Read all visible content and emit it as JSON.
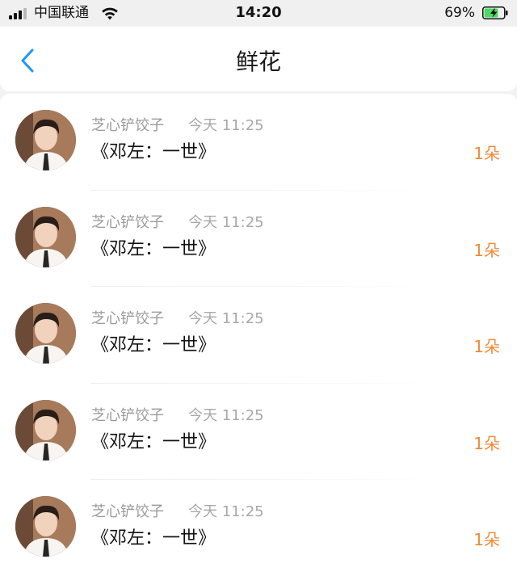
{
  "status_bar": {
    "carrier": "中国联通",
    "time": "14:20",
    "battery": "69%"
  },
  "header": {
    "title": "鲜花",
    "back_icon": "chevron-left-icon"
  },
  "list": {
    "items": [
      {
        "user": "芝心铲饺子",
        "time": "今天 11:25",
        "title": "《邓左：一世》",
        "count": "1朵"
      },
      {
        "user": "芝心铲饺子",
        "time": "今天 11:25",
        "title": "《邓左：一世》",
        "count": "1朵"
      },
      {
        "user": "芝心铲饺子",
        "time": "今天 11:25",
        "title": "《邓左：一世》",
        "count": "1朵"
      },
      {
        "user": "芝心铲饺子",
        "time": "今天 11:25",
        "title": "《邓左：一世》",
        "count": "1朵"
      },
      {
        "user": "芝心铲饺子",
        "time": "今天 11:25",
        "title": "《邓左：一世》",
        "count": "1朵"
      }
    ]
  },
  "colors": {
    "accent": "#2196f3",
    "count": "#f08a38",
    "battery_charge": "#4cd964"
  }
}
